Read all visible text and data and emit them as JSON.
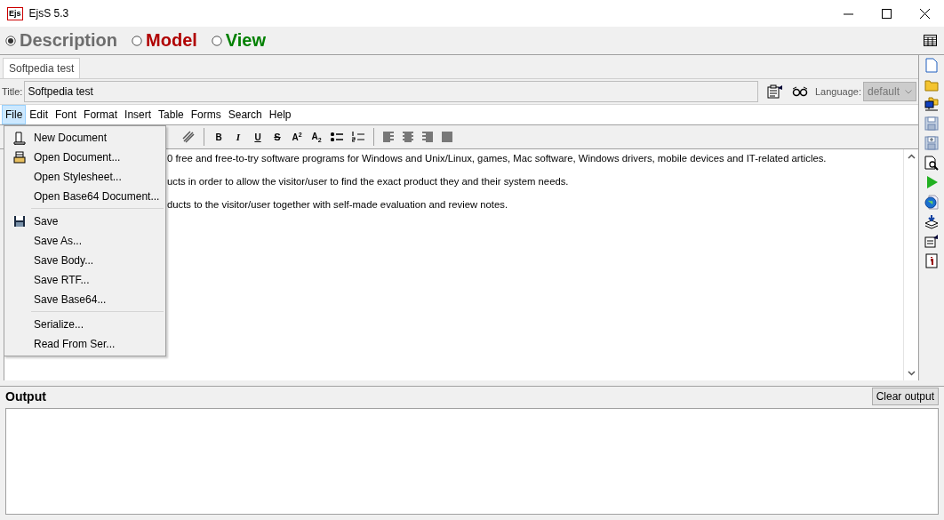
{
  "window": {
    "title": "EjsS 5.3",
    "icon_label": "Ejs"
  },
  "modes": [
    {
      "label": "Description",
      "selected": true,
      "color": "#6d6d6d"
    },
    {
      "label": "Model",
      "selected": false,
      "color": "#b00000"
    },
    {
      "label": "View",
      "selected": false,
      "color": "#008000"
    }
  ],
  "tabs": [
    {
      "label": "Softpedia test",
      "selected": true
    }
  ],
  "title_field": {
    "label": "Title:",
    "value": "Softpedia test"
  },
  "language": {
    "label": "Language:",
    "value": "default",
    "disabled": true
  },
  "menu_bar": [
    {
      "label": "File",
      "selected": true
    },
    {
      "label": "Edit",
      "selected": false
    },
    {
      "label": "Font",
      "selected": false
    },
    {
      "label": "Format",
      "selected": false
    },
    {
      "label": "Insert",
      "selected": false
    },
    {
      "label": "Table",
      "selected": false
    },
    {
      "label": "Forms",
      "selected": false
    },
    {
      "label": "Search",
      "selected": false
    },
    {
      "label": "Help",
      "selected": false
    }
  ],
  "format_buttons": [
    {
      "label": "B",
      "kind": "bold"
    },
    {
      "label": "I",
      "kind": "italic"
    },
    {
      "label": "U",
      "kind": "underline"
    },
    {
      "label": "S",
      "kind": "strike"
    },
    {
      "label": "A$^{2}$",
      "kind": "plain"
    },
    {
      "label": "A$_{2}$",
      "kind": "plain"
    }
  ],
  "document": {
    "lines": [
      "0 free and free-to-try software programs for Windows and Unix/Linux, games, Mac software, Windows drivers, mobile devices and IT-related articles.",
      "ucts in order to allow the visitor/user to find the exact product they and their system needs.",
      "ducts to the visitor/user together with self-made evaluation and review notes."
    ]
  },
  "file_menu": [
    {
      "kind": "new",
      "label": "New Document"
    },
    {
      "kind": "open",
      "label": "Open Document..."
    },
    {
      "kind": "item",
      "label": "Open Stylesheet..."
    },
    {
      "kind": "item",
      "label": "Open Base64 Document..."
    },
    {
      "kind": "separator"
    },
    {
      "kind": "save",
      "label": "Save"
    },
    {
      "kind": "item",
      "label": "Save As..."
    },
    {
      "kind": "item",
      "label": "Save Body..."
    },
    {
      "kind": "item",
      "label": "Save RTF..."
    },
    {
      "kind": "item",
      "label": "Save Base64..."
    },
    {
      "kind": "separator"
    },
    {
      "kind": "item",
      "label": "Serialize..."
    },
    {
      "kind": "item",
      "label": "Read From Ser..."
    }
  ],
  "output": {
    "title": "Output",
    "button": "Clear output"
  }
}
